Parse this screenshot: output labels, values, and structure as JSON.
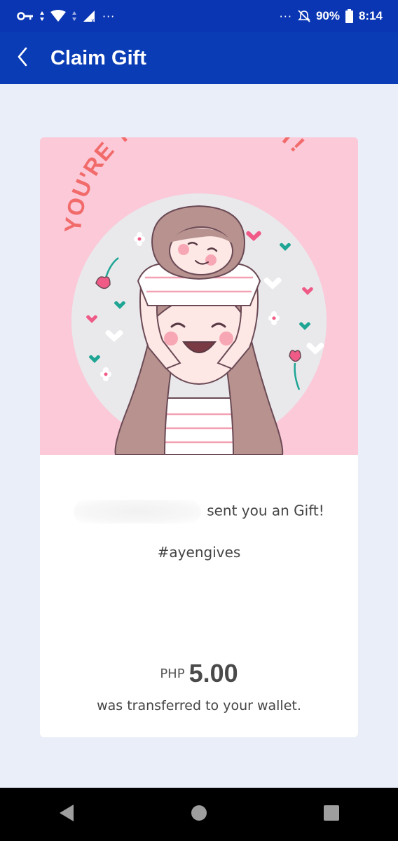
{
  "status_bar": {
    "battery_percent": "90%",
    "time": "8:14",
    "left_dots": "···",
    "right_dots": "···"
  },
  "app_bar": {
    "title": "Claim Gift",
    "color": "#0a3cb5"
  },
  "gift_card": {
    "image_headline": "YOU'RE THE GREATEST!",
    "sender_message": "sent you an Gift!",
    "hashtag": "#ayengives",
    "currency": "PHP",
    "amount": "5.00",
    "transfer_note": "was transferred to your wallet."
  },
  "icons": {
    "back": "chevron-left-icon",
    "vpn_key": "key-icon",
    "wifi": "wifi-icon",
    "signal": "signal-icon",
    "mute": "bell-off-icon",
    "battery": "battery-icon",
    "nav_back": "triangle-back-icon",
    "nav_home": "circle-home-icon",
    "nav_recents": "square-recents-icon"
  }
}
